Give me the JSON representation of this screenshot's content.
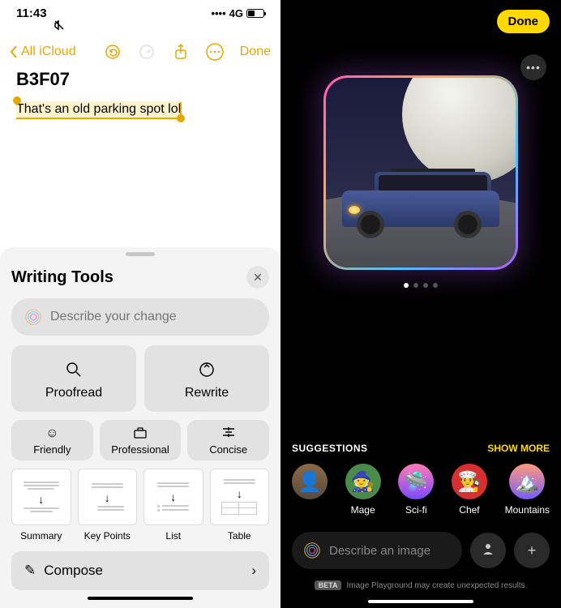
{
  "status": {
    "time": "11:43",
    "network": "4G"
  },
  "nav": {
    "back": "All iCloud",
    "done": "Done"
  },
  "note": {
    "title": "B3F07",
    "selected": "That's an old parking spot lol"
  },
  "sheet": {
    "title": "Writing Tools",
    "describe_placeholder": "Describe your change",
    "proofread": "Proofread",
    "rewrite": "Rewrite",
    "friendly": "Friendly",
    "professional": "Professional",
    "concise": "Concise",
    "summary": "Summary",
    "keypoints": "Key Points",
    "list": "List",
    "table": "Table",
    "compose": "Compose"
  },
  "playground": {
    "done": "Done",
    "suggestions_title": "SUGGESTIONS",
    "show_more": "SHOW MORE",
    "items": {
      "mage": "Mage",
      "scifi": "Sci-fi",
      "chef": "Chef",
      "mountains": "Mountains"
    },
    "describe_placeholder": "Describe an image",
    "beta": "BETA",
    "footer": "Image Playground may create unexpected results."
  }
}
